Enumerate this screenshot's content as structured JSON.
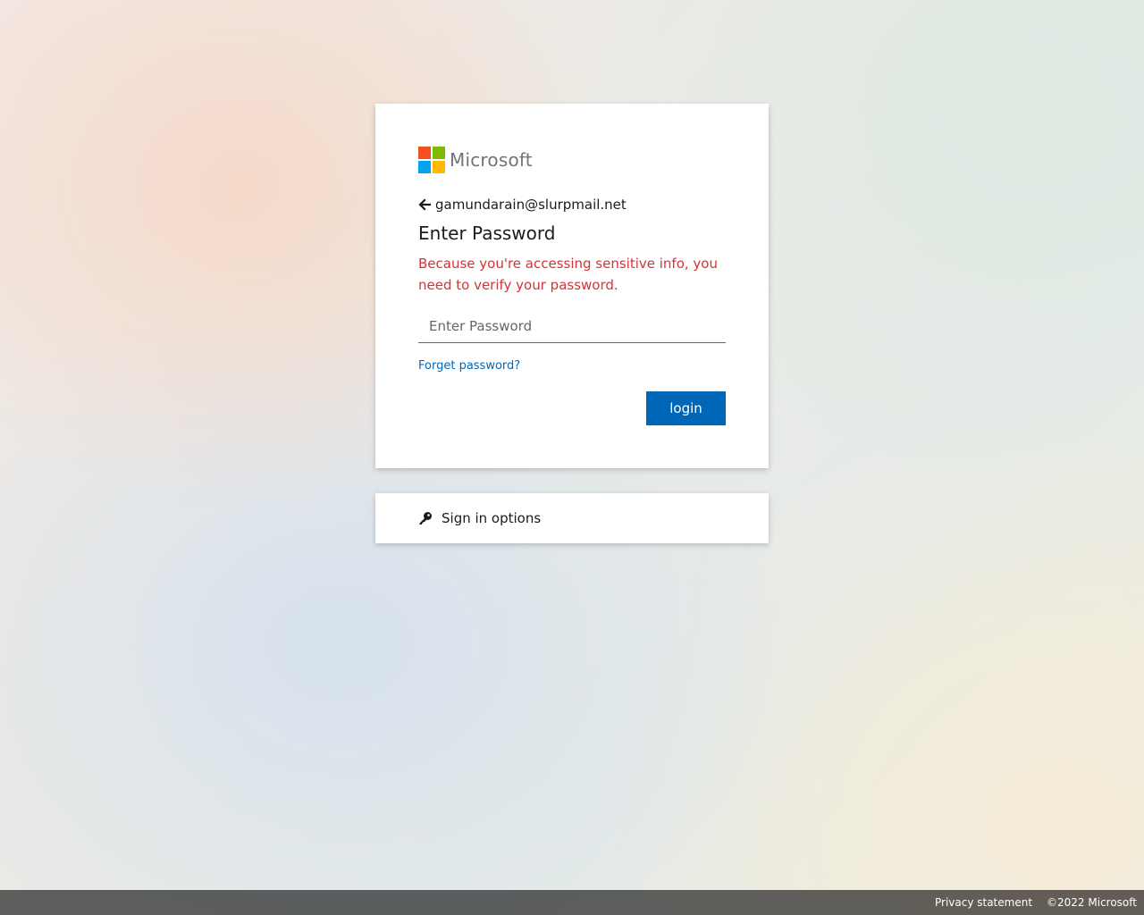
{
  "brand": {
    "name": "Microsoft",
    "logo_colors": [
      "#f25022",
      "#7fba00",
      "#00a4ef",
      "#ffb900"
    ]
  },
  "identity": {
    "back_icon": "arrow-left-icon",
    "email": "gamundarain@slurpmail.net"
  },
  "form": {
    "title": "Enter Password",
    "error_message": "Because you're accessing sensitive info, you need to verify your password.",
    "password_placeholder": "Enter Password",
    "password_value": "",
    "forgot_link": "Forget password?",
    "submit_label": "login"
  },
  "sign_in_options": {
    "icon": "key-icon",
    "label": "Sign in options"
  },
  "footer": {
    "privacy_link": "Privacy statement",
    "copyright": "©2022 Microsoft"
  },
  "colors": {
    "accent": "#0067b8",
    "error": "#d13438",
    "text": "#1b1b1b",
    "logo_text": "#737373"
  }
}
